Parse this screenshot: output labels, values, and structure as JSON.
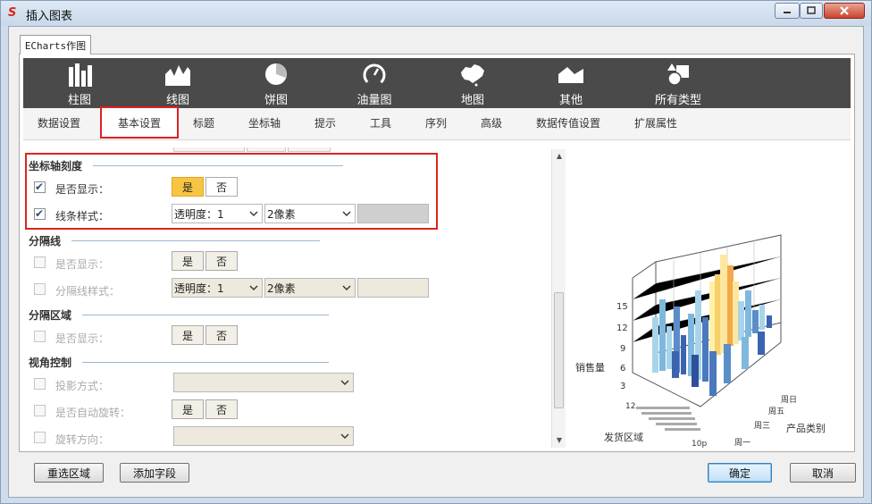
{
  "window": {
    "title": "插入图表"
  },
  "tab": {
    "label": "ECharts作图"
  },
  "chart_types": [
    {
      "label": "柱图",
      "icon": "bar-chart-icon"
    },
    {
      "label": "线图",
      "icon": "line-chart-icon"
    },
    {
      "label": "饼图",
      "icon": "pie-chart-icon"
    },
    {
      "label": "油量图",
      "icon": "gauge-icon"
    },
    {
      "label": "地图",
      "icon": "map-icon"
    },
    {
      "label": "其他",
      "icon": "area-chart-icon"
    },
    {
      "label": "所有类型",
      "icon": "shapes-icon"
    }
  ],
  "sub_tabs": [
    "数据设置",
    "基本设置",
    "标题",
    "坐标轴",
    "提示",
    "工具",
    "序列",
    "高级",
    "数据传值设置",
    "扩展属性"
  ],
  "active_sub_tab": "基本设置",
  "sections": {
    "axis_tick": {
      "title": "坐标轴刻度",
      "show_label": "是否显示：",
      "show_checked": true,
      "yes": "是",
      "no": "否",
      "style_label": "线条样式：",
      "style_checked": true,
      "opacity_value": "透明度：1",
      "width_value": "2像素"
    },
    "split_line": {
      "title": "分隔线",
      "show_label": "是否显示：",
      "yes": "是",
      "no": "否",
      "style_label": "分隔线样式：",
      "opacity_value": "透明度：1",
      "width_value": "2像素"
    },
    "split_area": {
      "title": "分隔区域",
      "show_label": "是否显示：",
      "yes": "是",
      "no": "否"
    },
    "view_control": {
      "title": "视角控制",
      "projection_label": "投影方式：",
      "auto_rotate_label": "是否自动旋转：",
      "yes": "是",
      "no": "否",
      "rotate_dir_label": "旋转方向："
    }
  },
  "preview": {
    "z_ticks": [
      "15",
      "12",
      "9",
      "6",
      "3"
    ],
    "z_label": "销售量",
    "x_label": "发货区域",
    "y_label": "产品类别",
    "y_ticks": [
      "周日",
      "周五",
      "周三",
      "周一"
    ],
    "x_ticks": [
      "12",
      "10p"
    ]
  },
  "buttons": {
    "reselect": "重选区域",
    "add_field": "添加字段",
    "ok": "确定",
    "cancel": "取消"
  },
  "colors": {
    "highlight": "#d9261c",
    "active_toggle": "#f7c443",
    "toolbar_bg": "#4a4a4a"
  }
}
